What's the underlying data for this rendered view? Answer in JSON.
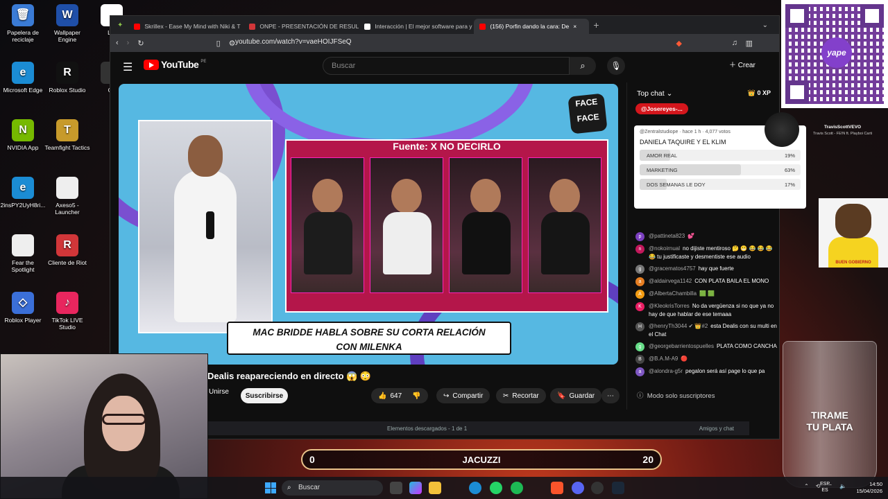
{
  "desktop_icons": [
    {
      "label": "Papelera de reciclaje",
      "color": "#3a7bd5",
      "glyph": "🗑"
    },
    {
      "label": "Wallpaper Engine",
      "color": "#1f4fa8",
      "glyph": "W"
    },
    {
      "label": "Let",
      "color": "#fff",
      "glyph": ""
    },
    {
      "label": "Microsoft Edge",
      "color": "#1b8cd4",
      "glyph": "e"
    },
    {
      "label": "Roblox Studio",
      "color": "#111",
      "glyph": "R"
    },
    {
      "label": "Cu",
      "color": "#333",
      "glyph": ""
    },
    {
      "label": "NVIDIA App",
      "color": "#76b900",
      "glyph": "N"
    },
    {
      "label": "Teamfight Tactics",
      "color": "#c79a2b",
      "glyph": "T"
    },
    {
      "label": "2insPY2UyH8ri...",
      "color": "#1b8cd4",
      "glyph": "e"
    },
    {
      "label": "Axeso5 - Launcher",
      "color": "#eee",
      "glyph": ""
    },
    {
      "label": "Fear the Spotlight",
      "color": "#eee",
      "glyph": ""
    },
    {
      "label": "Cliente de Riot",
      "color": "#d13639",
      "glyph": "R"
    },
    {
      "label": "Roblox Player",
      "color": "#3b6fd8",
      "glyph": "◇"
    },
    {
      "label": "TikTok LIVE Studio",
      "color": "#e8265e",
      "glyph": "♪"
    }
  ],
  "browser": {
    "tabs": [
      {
        "label": "Skrillex - Ease My Mind with Niki & T",
        "active": false,
        "fav_color": "#ff0000"
      },
      {
        "label": "ONPE - PRESENTACIÓN DE RESULTA",
        "active": false,
        "fav_color": "#d13639"
      },
      {
        "label": "Interacción | El mejor software para y",
        "active": false,
        "fav_color": "#ffffff"
      },
      {
        "label": "(156) Porfin dando la cara: De",
        "active": true,
        "fav_color": "#ff0000"
      }
    ],
    "url": "youtube.com/watch?v=vaeHOIJFSeQ"
  },
  "youtube": {
    "logo": "YouTube",
    "logo_country": "PE",
    "search_placeholder": "Buscar",
    "create_label": "Crear",
    "video": {
      "panel_title": "Fuente: X NO DECIRLO",
      "caption_line1": "MAC BRIDDE HABLA SOBRE SU CORTA RELACIÓN",
      "caption_line2": "CON MILENKA",
      "logo_top": "FACE",
      "logo_bottom": "FACE"
    },
    "title": "Dealis reapareciendo en directo 😱 😳",
    "join_label": "Unirse",
    "subscribe_label": "Suscribirse",
    "actions": [
      {
        "icon": "👍",
        "label": "647"
      },
      {
        "icon": "↪",
        "label": "Compartir"
      },
      {
        "icon": "✂",
        "label": "Recortar"
      },
      {
        "icon": "🔖",
        "label": "Guardar"
      }
    ]
  },
  "chat": {
    "header": "Top chat",
    "xp": "0 XP",
    "pinned_user": "@Josereyes-...",
    "poll": {
      "meta": "@Zentralstudiope · hace 1 h · 4,077 votos",
      "question": "DANIELA TAQUIRE Y EL KLIM",
      "options": [
        {
          "label": "AMOR REAL",
          "percent": 19
        },
        {
          "label": "MARKETING",
          "percent": 63
        },
        {
          "label": "DOS SEMANAS LE DOY",
          "percent": 17
        }
      ]
    },
    "messages": [
      {
        "author": "@pattineta823",
        "text": "💕",
        "avatar": "p",
        "color": "#7b3fbf"
      },
      {
        "author": "@nokoirnual",
        "text": "no dijiste mentiroso 🤔 😬 😂 😂 😂 😂 tu justificaste y desmentiste ese audio",
        "avatar": "n",
        "color": "#c2185b"
      },
      {
        "author": "@gracematos4757",
        "text": "hay que fuerte",
        "avatar": "g",
        "color": "#777"
      },
      {
        "author": "@aldairvega1142",
        "text": "CON PLATA BAILA EL MONO",
        "avatar": "a",
        "color": "#e67e22"
      },
      {
        "author": "@AlbertaChambilla",
        "text": "🟩 🟩",
        "avatar": "A",
        "color": "#f39c12"
      },
      {
        "author": "@KleokrisTorres",
        "text": "No da vergüenza si no que ya no hay de que hablar de ese temaaa",
        "avatar": "K",
        "color": "#e91e63"
      },
      {
        "author": "@henryTh3044 ✔ 👑#2",
        "text": "esta Dealis con su multi en el Chat",
        "avatar": "H",
        "color": "#555"
      },
      {
        "author": "@georgebarrientospuelles",
        "text": "PLATA COMO CANCHA",
        "avatar": "g",
        "color": "#6d8"
      },
      {
        "author": "@B.A.M-A9",
        "text": "🔴",
        "avatar": "B",
        "color": "#444"
      },
      {
        "author": "@alondra-g5r",
        "text": "pegalon será así page lo que pa",
        "avatar": "a",
        "color": "#7e57c2"
      }
    ],
    "footer": "Modo solo suscriptores"
  },
  "overlays": {
    "qr_badge": "yape",
    "artist_name": "TravisScottVEVO",
    "artist_sub": "Travis Scott - FE!N ft. Playboi Carti",
    "dog_caption": "BUEN GOBIERNO",
    "glass_line1": "TIRAME",
    "glass_line2": "TU PLATA"
  },
  "downloads_bar": {
    "center": "Elementos descargados - 1 de 1",
    "right": "Amigos y chat"
  },
  "scoreboard": {
    "left": "0",
    "center": "JACUZZI",
    "right": "20"
  },
  "taskbar": {
    "search": "Buscar",
    "lang_top": "ESP",
    "lang_bottom": "ES",
    "time": "14:50",
    "date": "15/04/2026"
  }
}
